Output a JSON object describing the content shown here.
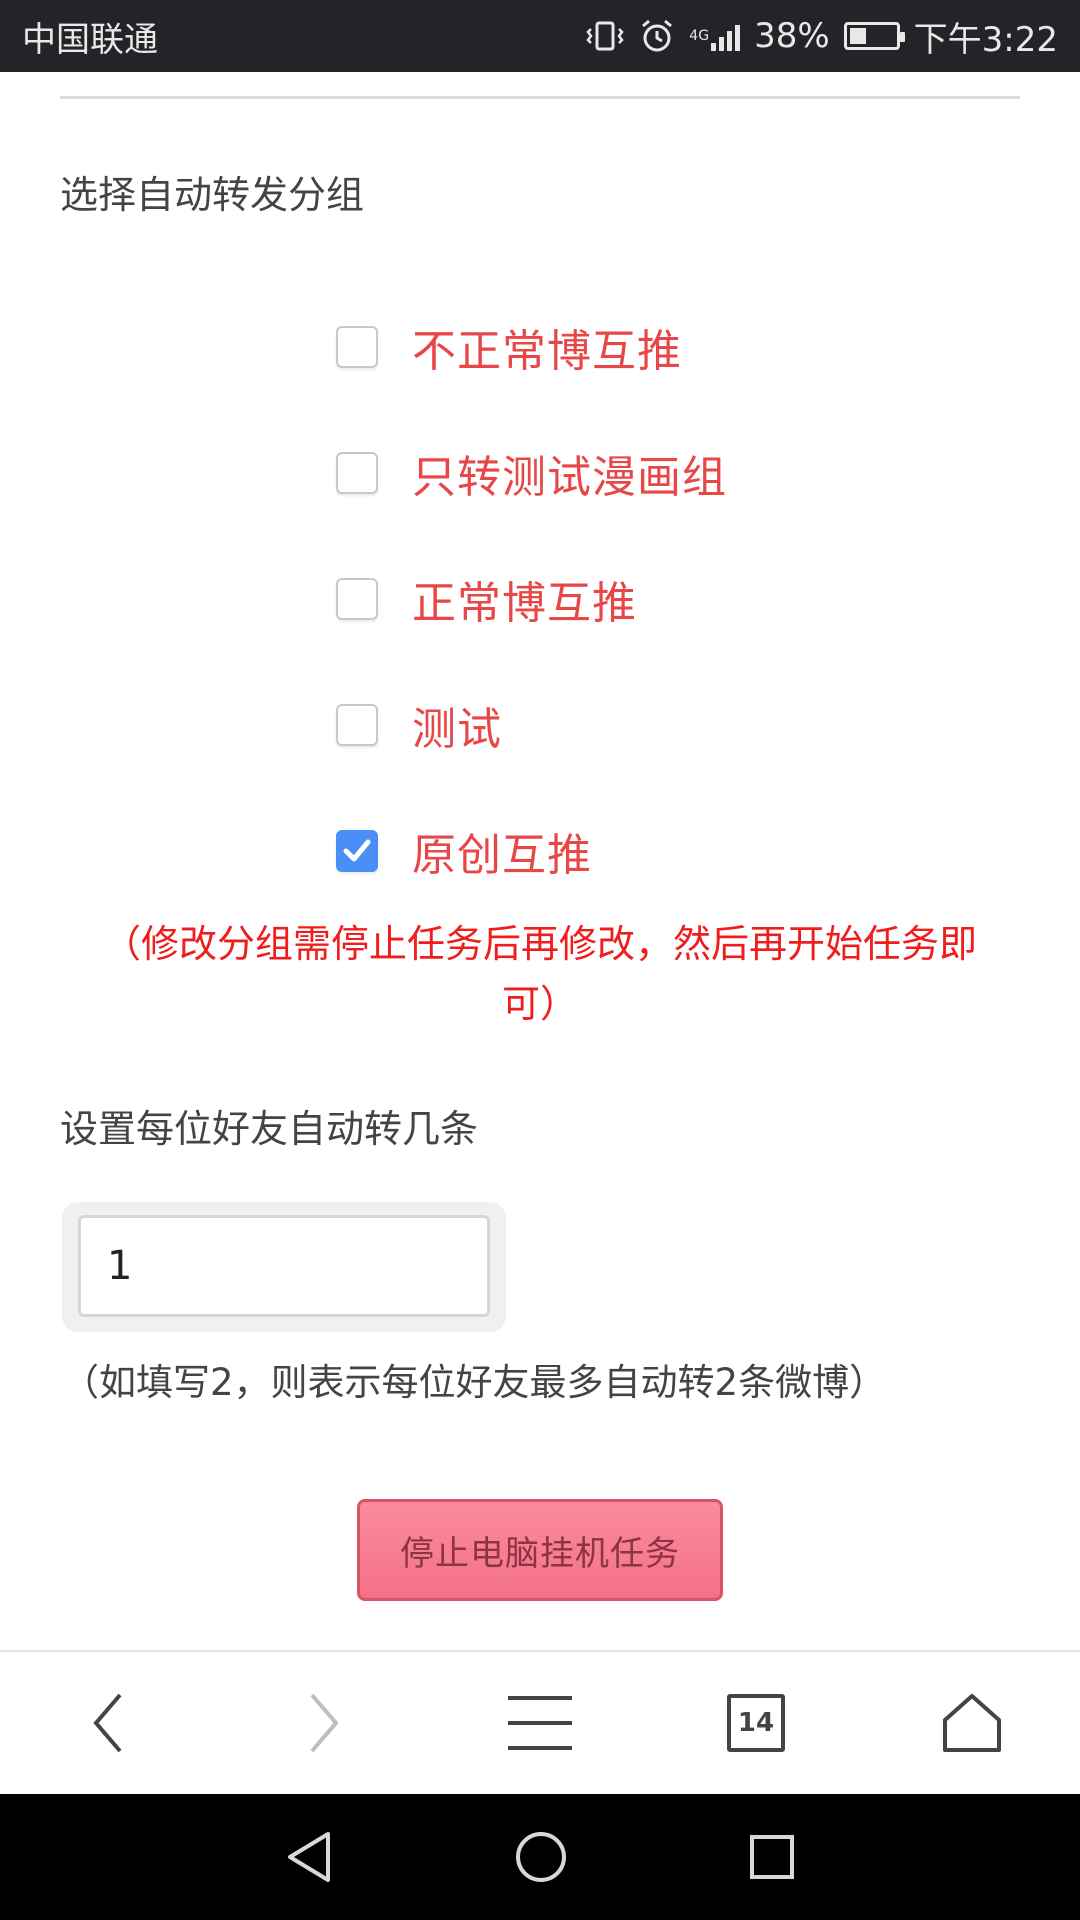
{
  "status_bar": {
    "carrier": "中国联通",
    "network": "4G",
    "battery": "38%",
    "battery_level": 0.38,
    "time": "下午3:22"
  },
  "groups_section": {
    "label": "选择自动转发分组",
    "items": [
      {
        "label": "不正常博互推",
        "checked": false
      },
      {
        "label": "只转测试漫画组",
        "checked": false
      },
      {
        "label": "正常博互推",
        "checked": false
      },
      {
        "label": "测试",
        "checked": false
      },
      {
        "label": "原创互推",
        "checked": true
      }
    ],
    "warning": "（修改分组需停止任务后再修改，然后再开始任务即可）"
  },
  "count_section": {
    "label": "设置每位好友自动转几条",
    "value": "1",
    "hint": "（如填写2，则表示每位好友最多自动转2条微博）"
  },
  "actions": {
    "stop_label": "停止电脑挂机任务"
  },
  "browser_bar": {
    "tab_count": "14"
  },
  "colors": {
    "group_label": "#e74747",
    "warning": "#f01d1d",
    "checkbox_checked": "#4a8ef7",
    "stop_button": "#f57186"
  }
}
